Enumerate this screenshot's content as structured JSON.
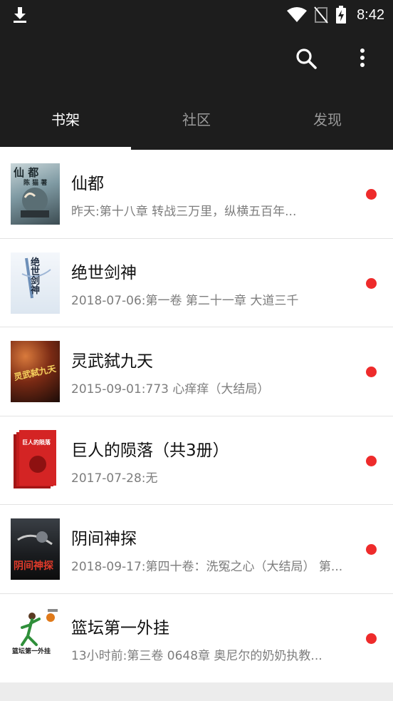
{
  "status_bar": {
    "time": "8:42"
  },
  "tabs": [
    {
      "label": "书架",
      "active": true
    },
    {
      "label": "社区",
      "active": false
    },
    {
      "label": "发现",
      "active": false
    }
  ],
  "books": [
    {
      "title": "仙都",
      "subtitle": "昨天:第十八章 转战三万里，纵横五百年...",
      "cover_text": "仙 都",
      "cover_author": "陈 猫 著",
      "unread": true
    },
    {
      "title": "绝世剑神",
      "subtitle": "2018-07-06:第一卷 第二十一章 大道三千",
      "cover_text": "绝世剑神",
      "unread": true
    },
    {
      "title": "灵武弑九天",
      "subtitle": "2015-09-01:773 心痒痒（大结局）",
      "cover_text": "灵武弑九天",
      "unread": true
    },
    {
      "title": "巨人的陨落（共3册）",
      "subtitle": "2017-07-28:无",
      "cover_text": "巨人的陨落",
      "unread": true
    },
    {
      "title": "阴间神探",
      "subtitle": "2018-09-17:第四十卷：洗冤之心（大结局） 第...",
      "cover_text": "阴间神探",
      "unread": true
    },
    {
      "title": "篮坛第一外挂",
      "subtitle": "13小时前:第三卷 0648章 奥尼尔的奶奶执教...",
      "cover_text": "篮坛第一外挂",
      "unread": true
    }
  ],
  "colors": {
    "appbar": "#1d1d1d",
    "unread_dot": "#ee2b2b",
    "background": "#ececec"
  },
  "icons": [
    "download-icon",
    "wifi-icon",
    "no-sim-icon",
    "battery-charging-icon",
    "search-icon",
    "more-vertical-icon"
  ]
}
